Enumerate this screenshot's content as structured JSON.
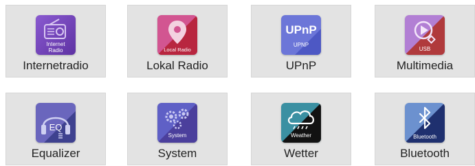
{
  "menu": {
    "tiles": [
      {
        "label": "Internetradio",
        "icon": "internet-radio-icon",
        "icon_text": [
          "Internet",
          "Radio"
        ],
        "colors": [
          "#7b4fc0",
          "#6a3eae"
        ]
      },
      {
        "label": "Lokal Radio",
        "icon": "location-pin-icon",
        "icon_text": [
          "Local Radio"
        ],
        "colors": [
          "#d04e88",
          "#b8284a"
        ]
      },
      {
        "label": "UPnP",
        "icon": "upnp-icon",
        "icon_text": [
          "UPnP",
          "UPNP"
        ],
        "colors": [
          "#6f78d6",
          "#4a56c2"
        ]
      },
      {
        "label": "Multimedia",
        "icon": "usb-play-icon",
        "icon_text": [
          "USB"
        ],
        "colors": [
          "#b07ad0",
          "#b53a3a"
        ]
      },
      {
        "label": "Equalizer",
        "icon": "equalizer-headphones-icon",
        "icon_text": [
          "EQ"
        ],
        "colors": [
          "#6a63b8",
          "#3d3f8c"
        ]
      },
      {
        "label": "System",
        "icon": "gears-icon",
        "icon_text": [
          "System"
        ],
        "colors": [
          "#5e5fc2",
          "#4a3e9a"
        ]
      },
      {
        "label": "Wetter",
        "icon": "weather-cloud-icon",
        "icon_text": [
          "Weather"
        ],
        "colors": [
          "#3c8ea0",
          "#111111"
        ]
      },
      {
        "label": "Bluetooth",
        "icon": "bluetooth-icon",
        "icon_text": [
          "Bluetooth"
        ],
        "colors": [
          "#6b8fce",
          "#1e2f6e"
        ]
      }
    ]
  }
}
